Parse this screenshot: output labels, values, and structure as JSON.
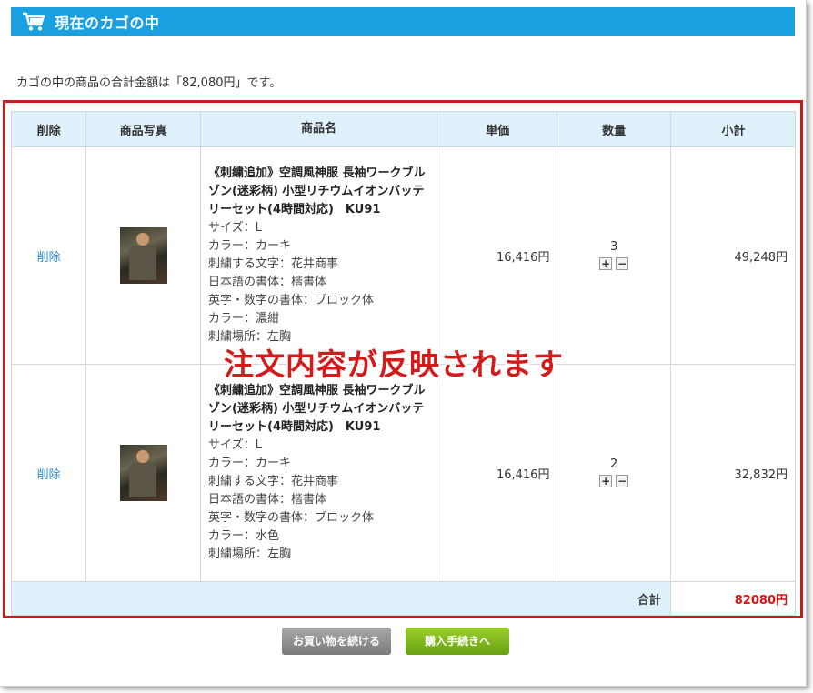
{
  "header": {
    "title": "現在のカゴの中",
    "icon": "cart-icon"
  },
  "summary_text": "カゴの中の商品の合計金額は「82,080円」です。",
  "table": {
    "headers": [
      "削除",
      "商品写真",
      "商品名",
      "単価",
      "数量",
      "小計"
    ],
    "rows": [
      {
        "delete_label": "削除",
        "name": "《刺繍追加》空調風神服 長袖ワークブルゾン(迷彩柄) 小型リチウムイオンバッテリーセット(4時間対応)　KU91",
        "attrs": [
          "サイズ：L",
          "カラー：カーキ",
          "刺繍する文字：花井商事",
          "日本語の書体：楷書体",
          "英字・数字の書体：ブロック体",
          "カラー：濃紺",
          "刺繍場所：左胸"
        ],
        "price": "16,416円",
        "qty": "3",
        "subtotal": "49,248円"
      },
      {
        "delete_label": "削除",
        "name": "《刺繍追加》空調風神服 長袖ワークブルゾン(迷彩柄) 小型リチウムイオンバッテリーセット(4時間対応)　KU91",
        "attrs": [
          "サイズ：L",
          "カラー：カーキ",
          "刺繍する文字：花井商事",
          "日本語の書体：楷書体",
          "英字・数字の書体：ブロック体",
          "カラー：水色",
          "刺繍場所：左胸"
        ],
        "price": "16,416円",
        "qty": "2",
        "subtotal": "32,832円"
      }
    ],
    "total_label": "合計",
    "total_value": "82080円"
  },
  "qty_plus": "+",
  "qty_minus": "−",
  "overlay_note": "注文内容が反映されます",
  "buttons": {
    "continue": "お買い物を続ける",
    "checkout": "購入手続きへ"
  },
  "colors": {
    "header_bg": "#1aa0e0",
    "highlight_border": "#c81d1d",
    "total_price": "#e01010",
    "link": "#2f8fd6"
  }
}
